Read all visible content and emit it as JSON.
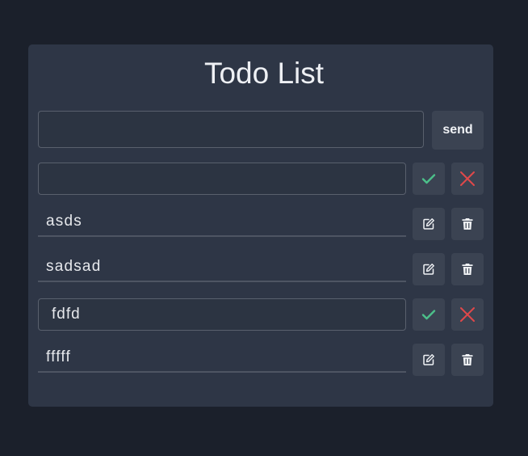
{
  "app": {
    "title": "Todo List"
  },
  "new_todo": {
    "value": "",
    "placeholder": "",
    "send_label": "send"
  },
  "todos": [
    {
      "text": "",
      "mode": "editing",
      "actions": [
        "check-icon",
        "close-icon"
      ]
    },
    {
      "text": "asds",
      "mode": "view",
      "actions": [
        "edit-icon",
        "trash-icon"
      ]
    },
    {
      "text": "sadsad",
      "mode": "view",
      "actions": [
        "edit-icon",
        "trash-icon"
      ]
    },
    {
      "text": "fdfd",
      "mode": "editing",
      "actions": [
        "check-icon",
        "close-icon"
      ]
    },
    {
      "text": "fffff",
      "mode": "view",
      "actions": [
        "edit-icon",
        "trash-icon"
      ]
    }
  ],
  "colors": {
    "background": "#1b202b",
    "card": "#2e3646",
    "button": "#3b4352",
    "confirm": "#4cc08a",
    "cancel": "#e0484a"
  }
}
